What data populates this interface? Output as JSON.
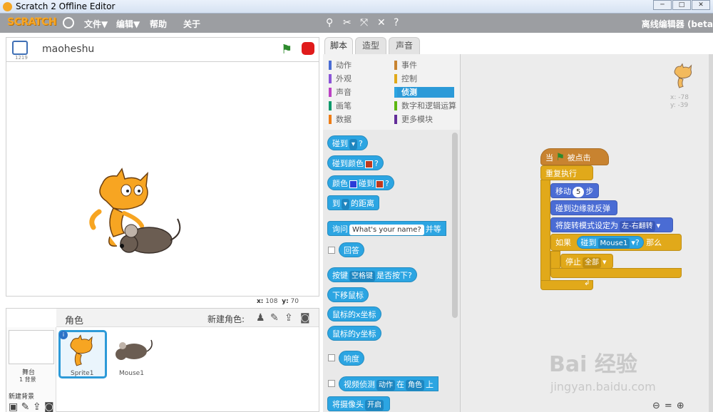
{
  "window": {
    "title": "Scratch 2 Offline Editor"
  },
  "menubar": {
    "logo": "SCRATCH",
    "file": "文件▼",
    "edit": "编辑▼",
    "help": "帮助",
    "about": "关于",
    "mode": "离线编辑器 (beta"
  },
  "stage": {
    "version": "1219",
    "project_name": "maoheshu",
    "x_label": "x:",
    "x_value": "108",
    "y_label": "y:",
    "y_value": "70"
  },
  "sprites": {
    "header": "角色",
    "new_sprite": "新建角色:",
    "stage_label": "舞台",
    "backdrops": "1 背景",
    "new_backdrop": "新建背景",
    "items": [
      {
        "name": "Sprite1"
      },
      {
        "name": "Mouse1"
      }
    ]
  },
  "tabs": [
    "脚本",
    "造型",
    "声音"
  ],
  "categories": [
    {
      "label": "动作",
      "color": "#4a6cd4"
    },
    {
      "label": "事件",
      "color": "#c88330"
    },
    {
      "label": "外观",
      "color": "#8a55d7"
    },
    {
      "label": "控制",
      "color": "#e1a91a"
    },
    {
      "label": "声音",
      "color": "#bb42c3"
    },
    {
      "label": "侦测",
      "color": "#2ca5e2"
    },
    {
      "label": "画笔",
      "color": "#0e9a6c"
    },
    {
      "label": "数字和逻辑运算",
      "color": "#5cb712"
    },
    {
      "label": "数据",
      "color": "#ee7d16"
    },
    {
      "label": "更多模块",
      "color": "#632d99"
    }
  ],
  "palette": {
    "touching": "碰到",
    "q": "?",
    "touching_color": "碰到颜色",
    "color": "颜色",
    "distance_to": "到",
    "distance": "的距离",
    "ask": "询问",
    "ask_default": "What's your name?",
    "ask_wait": "并等",
    "answer": "回答",
    "key": "按键",
    "key_space": "空格键",
    "key_pressed": "是否按下?",
    "mouse_down": "下移鼠标",
    "mouse_x": "鼠标的x坐标",
    "mouse_y": "鼠标的y坐标",
    "loudness": "响度",
    "video": "视频侦测",
    "video_motion": "动作",
    "video_on": "在",
    "video_sprite": "角色",
    "video_up": "上",
    "camera": "将摄像头",
    "camera_on": "开启"
  },
  "script": {
    "when": "当",
    "clicked": "被点击",
    "forever": "重复执行",
    "move": "移动",
    "steps_value": "5",
    "steps": "步",
    "bounce": "碰到边缘就反弹",
    "rotation": "将旋转模式设定为",
    "rotation_value": "左-右翻转",
    "if": "如果",
    "touching": "碰到",
    "target": "Mouse1",
    "q": "?",
    "then": "那么",
    "stop": "停止",
    "stop_value": "全部"
  },
  "sprite_info": {
    "x": "x: -78",
    "y": "y: -39"
  },
  "watermark": {
    "line1": "Bai 经验",
    "line2": "jingyan.baidu.com"
  }
}
